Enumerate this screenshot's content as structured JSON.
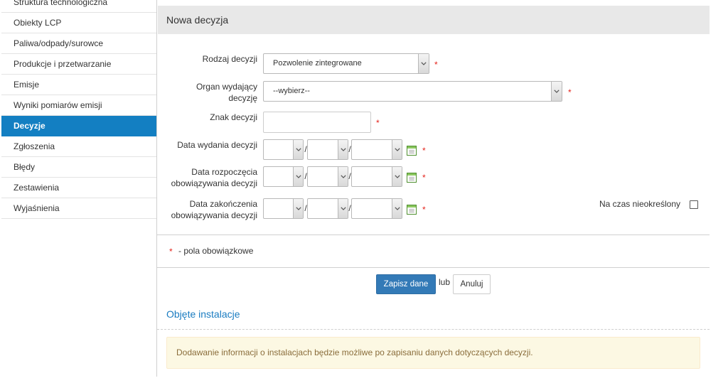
{
  "sidebar": {
    "items": [
      {
        "label": "Struktura technologiczna",
        "active": false
      },
      {
        "label": "Obiekty LCP",
        "active": false
      },
      {
        "label": "Paliwa/odpady/surowce",
        "active": false
      },
      {
        "label": "Produkcje i przetwarzanie",
        "active": false
      },
      {
        "label": "Emisje",
        "active": false
      },
      {
        "label": "Wyniki pomiarów emisji",
        "active": false
      },
      {
        "label": "Decyzje",
        "active": true
      },
      {
        "label": "Zgłoszenia",
        "active": false
      },
      {
        "label": "Błędy",
        "active": false
      },
      {
        "label": "Zestawienia",
        "active": false
      },
      {
        "label": "Wyjaśnienia",
        "active": false
      }
    ]
  },
  "panel": {
    "title": "Nowa decyzja"
  },
  "form": {
    "required_mark": "*",
    "date_separator": "/",
    "decision_type": {
      "label_lines": [
        "Rodzaj decyzji"
      ],
      "selected": "Pozwolenie zintegrowane"
    },
    "issuing_authority": {
      "label_lines": [
        "Organ wydający",
        "decyzję"
      ],
      "selected": "--wybierz--"
    },
    "decision_number": {
      "label_lines": [
        "Znak decyzji"
      ],
      "value": ""
    },
    "issue_date": {
      "label_lines": [
        "Data wydania decyzji"
      ],
      "day": "",
      "month": "",
      "year": ""
    },
    "validity_start": {
      "label_lines": [
        "Data rozpoczęcia",
        "obowiązywania decyzji"
      ],
      "day": "",
      "month": "",
      "year": ""
    },
    "validity_end": {
      "label_lines": [
        "Data zakończenia",
        "obowiązywania decyzji"
      ],
      "day": "",
      "month": "",
      "year": ""
    },
    "indefinite": {
      "label": "Na czas nieokreślony",
      "checked": false
    }
  },
  "legend": {
    "mark": "*",
    "text": "- pola obowiązkowe"
  },
  "actions": {
    "save_label": "Zapisz dane",
    "or_text": "lub",
    "cancel_label": "Anuluj"
  },
  "installations": {
    "title": "Objęte instalacje",
    "notice": "Dodawanie informacji o instalacjach będzie możliwe po zapisaniu danych dotyczących decyzji."
  },
  "icons": {
    "dropdown": "chevron-down-icon",
    "date_picker": "calendar-icon"
  },
  "theme": {
    "accent": "#137fc2",
    "primary_button": "#337ab7",
    "link": "#1a7cc1",
    "required": "#e4231b",
    "alert_background": "#fcf8e3",
    "alert_border": "#faebcc",
    "alert_text": "#8a6d3b",
    "panel_background": "#e8e8e8"
  }
}
